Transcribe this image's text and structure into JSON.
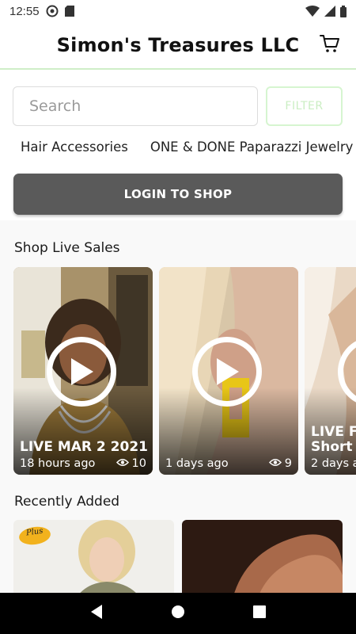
{
  "status_bar": {
    "time": "12:55"
  },
  "header": {
    "title": "Simon's Treasures LLC"
  },
  "search": {
    "placeholder": "Search",
    "filter_label": "FILTER"
  },
  "categories": [
    "Hair Accessories",
    "ONE & DONE Paparazzi Jewelry"
  ],
  "login_button": "LOGIN TO SHOP",
  "live_section": {
    "title": "Shop Live Sales",
    "cards": [
      {
        "title": "LIVE MAR 2 2021",
        "time": "18 hours ago",
        "views": "10"
      },
      {
        "title": "",
        "time": "1 days ago",
        "views": "9"
      },
      {
        "title_line1": "LIVE Fe",
        "title_line2": "Short L",
        "time": "2 days a"
      }
    ]
  },
  "recent_section": {
    "title": "Recently Added",
    "items": [
      {
        "badge": "Plus"
      },
      {
        "badge": ""
      }
    ]
  },
  "colors": {
    "accent_green": "#cfeec8",
    "login_bg": "#5a5a5a"
  }
}
